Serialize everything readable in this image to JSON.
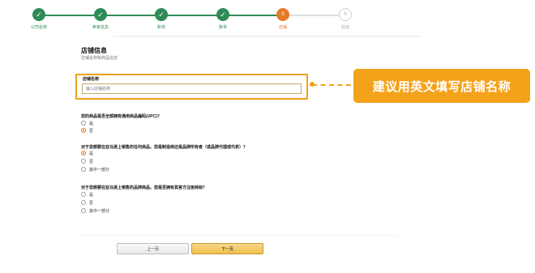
{
  "stepper": {
    "steps": [
      {
        "label": "公司名称",
        "state": "done"
      },
      {
        "label": "卖家信息",
        "state": "done"
      },
      {
        "label": "账单",
        "state": "done"
      },
      {
        "label": "账单",
        "state": "done"
      },
      {
        "label": "店铺",
        "state": "current",
        "number": "5"
      },
      {
        "label": "验证",
        "state": "todo",
        "number": "6"
      }
    ]
  },
  "section": {
    "title": "店铺信息",
    "subtitle": "店铺名称和商品信息"
  },
  "store_name": {
    "label": "店铺名称",
    "placeholder": "输入店铺名称",
    "value": ""
  },
  "callout": {
    "text": "建议用英文填写店铺名称"
  },
  "questions": [
    {
      "text": "您的商品是否全部拥有通用商品编码(UPC)?",
      "options": [
        {
          "label": "是",
          "checked": false
        },
        {
          "label": "否",
          "checked": true
        }
      ]
    },
    {
      "text": "对于您想要在亚马逊上销售的任何商品，您是制造商还是品牌所有者（或品牌代理或代表）？",
      "options": [
        {
          "label": "是",
          "checked": true
        },
        {
          "label": "否",
          "checked": false
        },
        {
          "label": "其中一部分",
          "checked": false
        }
      ]
    },
    {
      "text": "对于您想要在亚马逊上销售的品牌商品，您是否拥有其官方注册商标？",
      "options": [
        {
          "label": "是",
          "checked": false
        },
        {
          "label": "否",
          "checked": false
        },
        {
          "label": "其中一部分",
          "checked": false
        }
      ]
    }
  ],
  "buttons": {
    "prev": "上一页",
    "next": "下一页"
  },
  "colors": {
    "done": "#2e8b57",
    "current": "#e8782a",
    "highlight": "#f0a21a",
    "callout_bg": "#f5a21b"
  }
}
